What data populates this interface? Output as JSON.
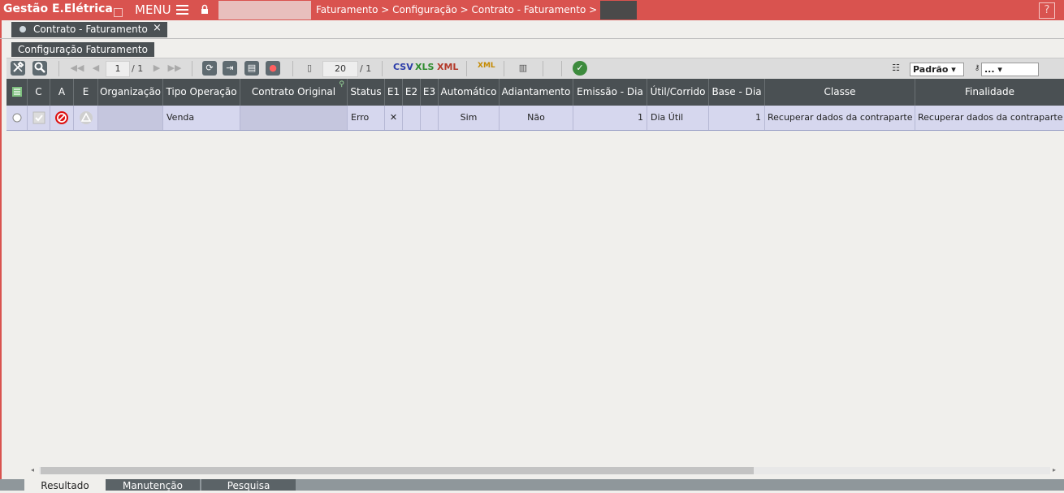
{
  "app": {
    "title": "Gestão E.Elétrica",
    "menu_label": "MENU",
    "breadcrumb": "Faturamento > Configuração > Contrato - Faturamento >",
    "help": "?"
  },
  "tabs": {
    "document_tab": "Contrato - Faturamento",
    "close": "×",
    "sub_tab": "Configuração Faturamento"
  },
  "toolbar": {
    "page_current": "1",
    "page_total": "/ 1",
    "rows_per_page": "20",
    "rows_total": "/ 1",
    "formats": {
      "csv": "CSV",
      "xls": "XLS",
      "xml": "XML",
      "xml_alt": "XML"
    },
    "layout_select": "Padrão",
    "filter_select": "..."
  },
  "table": {
    "headers": [
      "C",
      "A",
      "E",
      "Organização",
      "Tipo Operação",
      "Contrato Original",
      "Status",
      "E1",
      "E2",
      "E3",
      "Automático",
      "Adiantamento",
      "Emissão - Dia",
      "Útil/Corrido",
      "Base - Dia",
      "Classe",
      "Finalidade"
    ],
    "rows": [
      {
        "organizacao": "",
        "tipo_operacao": "Venda",
        "contrato_original": "",
        "status": "Erro",
        "e1": "✕",
        "e2": "",
        "e3": "",
        "automatico": "Sim",
        "adiantamento": "Não",
        "emissao_dia": "1",
        "util_corrido": "Dia Útil",
        "base_dia": "1",
        "classe": "Recuperar dados da contraparte",
        "finalidade": "Recuperar dados da contraparte"
      }
    ]
  },
  "bottom_tabs": [
    "Resultado",
    "Manutenção",
    "Pesquisa"
  ],
  "colors": {
    "accent": "#d9534f",
    "header": "#4a5053",
    "row_selected": "#d6d7ee"
  }
}
